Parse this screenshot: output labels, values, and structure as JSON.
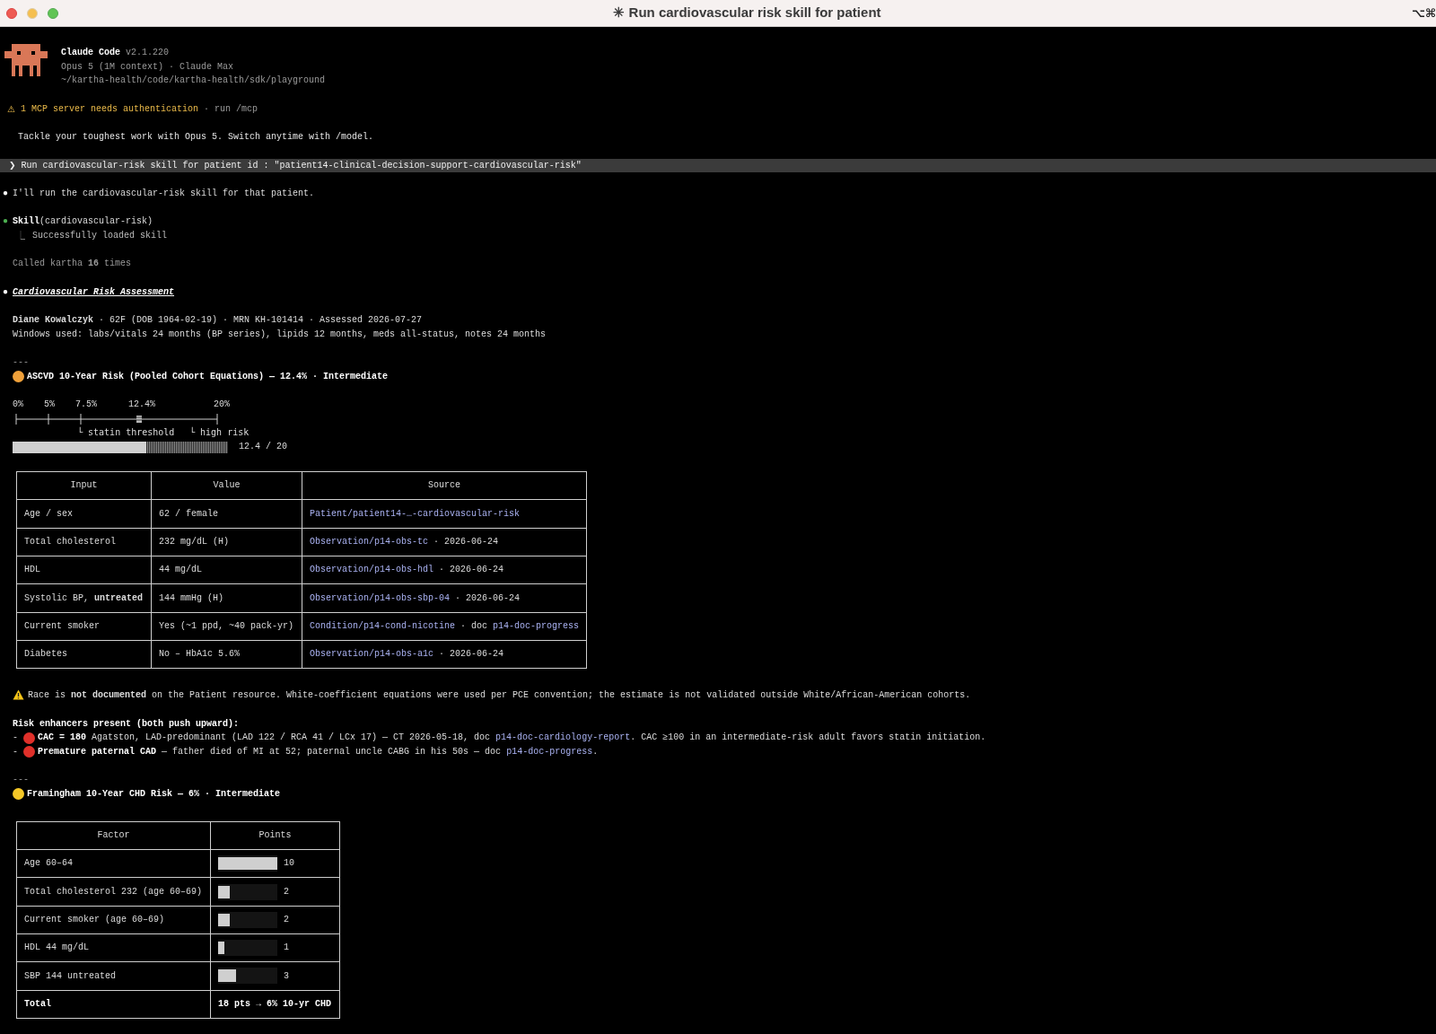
{
  "window": {
    "title": "✳ Run cardiovascular risk skill for patient",
    "shortcut": "⌥⌘"
  },
  "header": {
    "app_name": "Claude Code",
    "version": "v2.1.220",
    "model_line": "Opus 5 (1M context) · Claude Max",
    "path": "~/kartha-health/code/kartha-health/sdk/playground"
  },
  "notice": {
    "icon": "⚠",
    "message": "1 MCP server needs authentication",
    "hint": "· run /mcp"
  },
  "tip": "Tackle your toughest work with Opus 5. Switch anytime with /model.",
  "prompt": {
    "caret": "❯",
    "text": "Run cardiovascular-risk skill for patient id : \"patient14-clinical-decision-support-cardiovascular-risk\""
  },
  "transcript": [
    {
      "kind": "reply",
      "bullet": "●",
      "text": "I'll run the cardiovascular-risk skill for that patient."
    },
    {
      "kind": "tool",
      "bullet": "●",
      "name": "Skill",
      "args": "(cardiovascular-risk)",
      "connector": "⎿",
      "result": "Successfully loaded skill"
    },
    {
      "kind": "status",
      "text": "Called kartha **16** times"
    },
    {
      "kind": "heading",
      "bullet": "●",
      "text": "Cardiovascular Risk Assessment"
    }
  ],
  "patient_line": "**Diane Kowalczyk** · 62F (DOB 1964-02-19) · MRN KH-101414 · Assessed 2026-07-27",
  "windows_line": "Windows used: labs/vitals 24 months (BP series), lipids 12 months, meds all-status, notes 24 months",
  "ascvd": {
    "rule": "---",
    "color": "#f0a13a",
    "title": "ASCVD 10-Year Risk (Pooled Cohort Equations) — 12.4% · Intermediate",
    "scale": {
      "ticks": [
        "0%",
        "5%",
        "7.5%",
        "12.4%",
        "20%"
      ],
      "annotations": [
        "└ statin threshold",
        "└ high risk"
      ]
    },
    "level": 0.62,
    "reading": "12.4 / 20",
    "columns": [
      "Input",
      "Value",
      "Source"
    ],
    "rows": [
      {
        "input": "Age / sex",
        "value": "62 / female",
        "source": [
          {
            "kind": "link",
            "text": "Patient/patient14-…-cardiovascular-risk"
          }
        ]
      },
      {
        "input": "Total cholesterol",
        "value": "232 mg/dL (H)",
        "source": [
          {
            "kind": "link",
            "text": "Observation/p14-obs-tc"
          },
          {
            "kind": "text",
            "text": " · 2026-06-24"
          }
        ]
      },
      {
        "input": "HDL",
        "value": "44 mg/dL",
        "source": [
          {
            "kind": "link",
            "text": "Observation/p14-obs-hdl"
          },
          {
            "kind": "text",
            "text": " · 2026-06-24"
          }
        ]
      },
      {
        "input": "Systolic BP, **untreated**",
        "value": "144 mmHg (H)",
        "source": [
          {
            "kind": "link",
            "text": "Observation/p14-obs-sbp-04"
          },
          {
            "kind": "text",
            "text": " · 2026-06-24"
          }
        ]
      },
      {
        "input": "Current smoker",
        "value": "Yes (~1 ppd, ~40 pack-yr)",
        "source": [
          {
            "kind": "link",
            "text": "Condition/p14-cond-nicotine"
          },
          {
            "kind": "text",
            "text": " · doc "
          },
          {
            "kind": "link",
            "text": "p14-doc-progress"
          }
        ]
      },
      {
        "input": "Diabetes",
        "value": "No – HbA1c 5.6%",
        "source": [
          {
            "kind": "link",
            "text": "Observation/p14-obs-a1c"
          },
          {
            "kind": "text",
            "text": " · 2026-06-24"
          }
        ]
      }
    ]
  },
  "race_note": "Race is **not documented** on the Patient resource. White-coefficient equations were used per PCE convention; the estimate is not validated outside White/African-American cohorts.",
  "enhancers": {
    "title": "Risk enhancers present (both push upward):",
    "items": [
      {
        "dash": "-",
        "color": "#e0302a",
        "segments": [
          {
            "kind": "bold",
            "text": "CAC = 180"
          },
          {
            "kind": "text",
            "text": " Agatston, LAD-predominant (LAD 122 / RCA 41 / LCx 17) — CT 2026-05-18, doc "
          },
          {
            "kind": "link",
            "text": "p14-doc-cardiology-report"
          },
          {
            "kind": "text",
            "text": ". CAC ≥100 in an intermediate-risk adult favors statin initiation."
          }
        ]
      },
      {
        "dash": "-",
        "color": "#e0302a",
        "segments": [
          {
            "kind": "bold",
            "text": "Premature paternal CAD"
          },
          {
            "kind": "text",
            "text": " — father died of MI at 52; paternal uncle CABG in his 50s — doc "
          },
          {
            "kind": "link",
            "text": "p14-doc-progress"
          },
          {
            "kind": "text",
            "text": "."
          }
        ]
      }
    ]
  },
  "framingham": {
    "rule": "---",
    "color": "#f5c827",
    "title": "Framingham 10-Year CHD Risk — 6% · Intermediate",
    "columns": [
      "Factor",
      "Points"
    ],
    "rows": [
      {
        "kind": "factor",
        "factor": "Age 60–64",
        "level": 1.0,
        "points": "10"
      },
      {
        "kind": "factor",
        "factor": "Total cholesterol 232 (age 60–69)",
        "level": 0.2,
        "points": "2"
      },
      {
        "kind": "factor",
        "factor": "Current smoker (age 60–69)",
        "level": 0.2,
        "points": "2"
      },
      {
        "kind": "factor",
        "factor": "HDL 44 mg/dL",
        "level": 0.1,
        "points": "1"
      },
      {
        "kind": "factor",
        "factor": "SBP 144 untreated",
        "level": 0.3,
        "points": "3"
      },
      {
        "kind": "total",
        "factor": "Total",
        "points": "18 pts → 6% 10-yr CHD"
      }
    ]
  }
}
